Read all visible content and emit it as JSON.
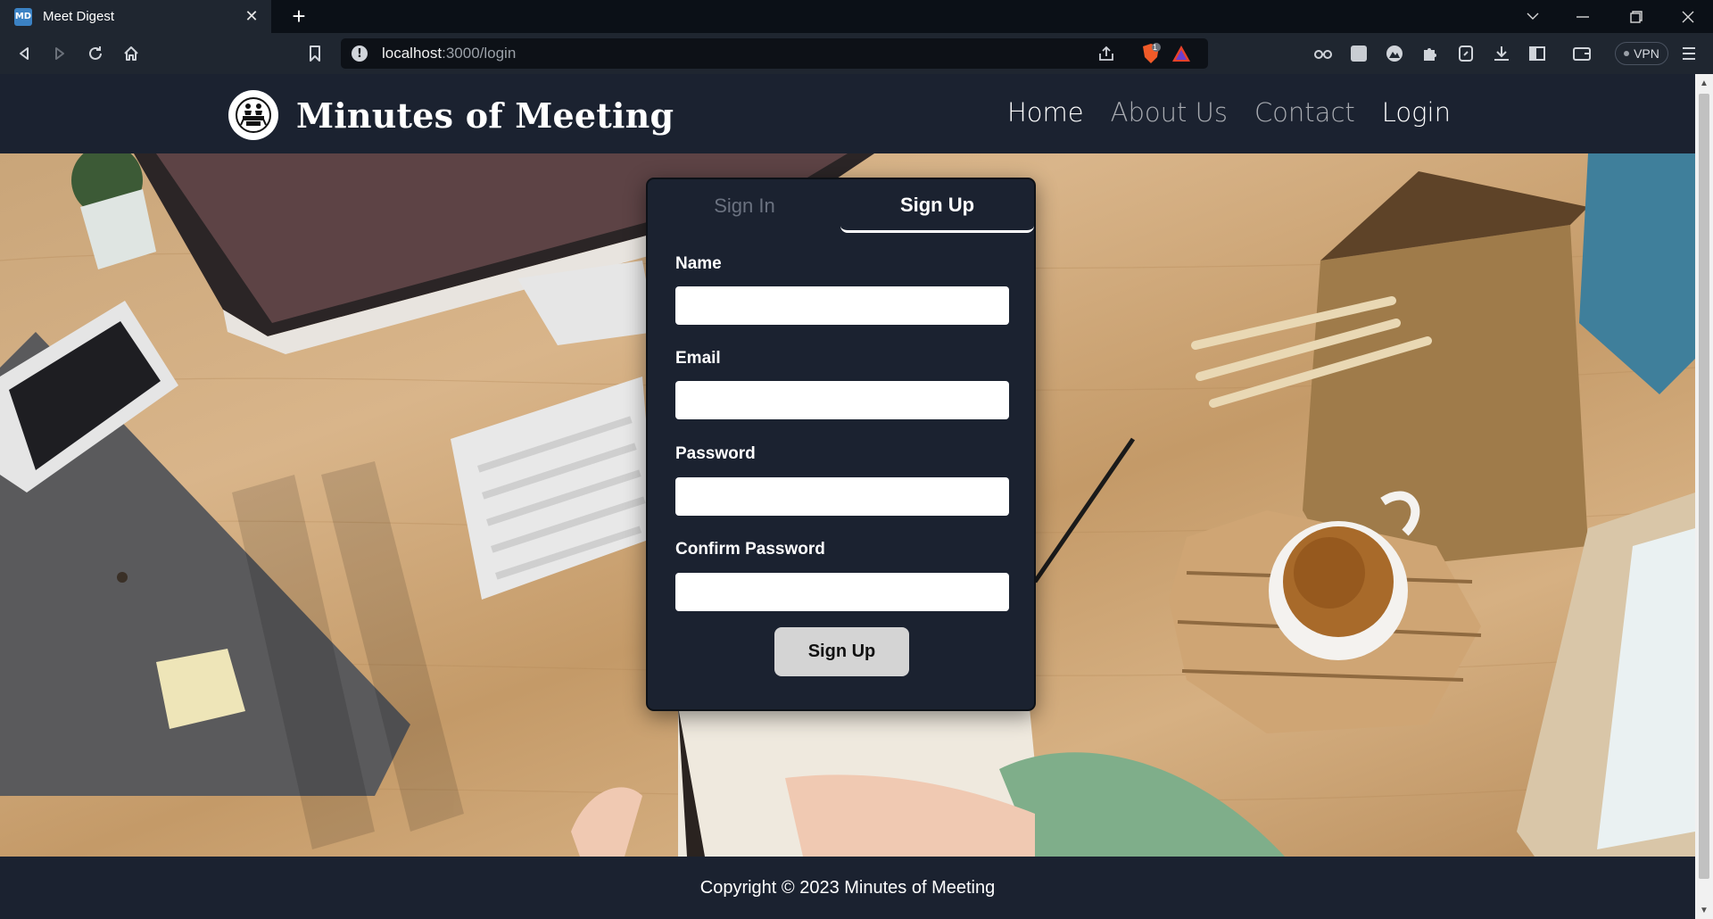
{
  "browser": {
    "tab_title": "Meet Digest",
    "favicon_text": "MD",
    "url_host": "localhost",
    "url_path": ":3000/login",
    "vpn_label": "VPN",
    "brave_badge": "1"
  },
  "site": {
    "brand": "Minutes of Meeting",
    "nav": [
      {
        "label": "Home",
        "active": true
      },
      {
        "label": "About Us",
        "active": false
      },
      {
        "label": "Contact",
        "active": false
      },
      {
        "label": "Login",
        "active": true
      }
    ]
  },
  "auth": {
    "tabs": {
      "sign_in": "Sign In",
      "sign_up": "Sign Up"
    },
    "active_tab": "Sign Up",
    "fields": {
      "name": "Name",
      "email": "Email",
      "password": "Password",
      "confirm_password": "Confirm Password"
    },
    "submit_label": "Sign Up"
  },
  "footer": {
    "text": "Copyright © 2023 Minutes of Meeting"
  },
  "colors": {
    "page_bg": "#1b2230",
    "card_bg": "#1b2230",
    "button_bg": "#d4d4d4",
    "browser_frame": "#0b1017"
  }
}
